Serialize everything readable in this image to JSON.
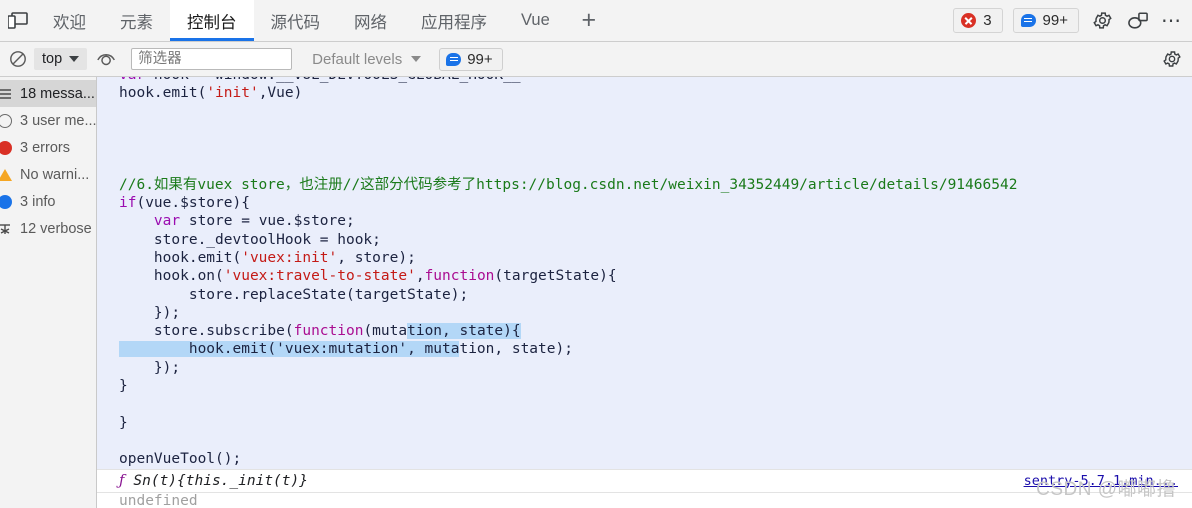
{
  "window": {
    "device_toolbar_icon": "device-toolbar-icon"
  },
  "tabbar": {
    "tabs": [
      {
        "label": "欢迎",
        "name": "tab-welcome",
        "active": false
      },
      {
        "label": "元素",
        "name": "tab-elements",
        "active": false
      },
      {
        "label": "控制台",
        "name": "tab-console",
        "active": true
      },
      {
        "label": "源代码",
        "name": "tab-sources",
        "active": false
      },
      {
        "label": "网络",
        "name": "tab-network",
        "active": false
      },
      {
        "label": "应用程序",
        "name": "tab-application",
        "active": false
      },
      {
        "label": "Vue",
        "name": "tab-vue",
        "active": false
      }
    ],
    "add_tab_label": "+",
    "error_count": "3",
    "message_count": "99+",
    "settings_icon": "gear-icon",
    "customize_icon": "devices-icon",
    "more_label": "⋯"
  },
  "console_toolbar": {
    "clear_icon": "clear-console-icon",
    "context_value": "top",
    "live_expression_icon": "eye-icon",
    "filter_placeholder": "筛选器",
    "filter_value": "",
    "levels_label": "Default levels",
    "badge_count": "99+",
    "settings_icon": "gear-icon"
  },
  "sidebar": {
    "items": [
      {
        "label": "18 messa...",
        "icon": "list-icon",
        "name": "sidebar-item-all-messages",
        "selected": true
      },
      {
        "label": "3 user me...",
        "icon": "circle-icon",
        "name": "sidebar-item-user-messages",
        "selected": false
      },
      {
        "label": "3 errors",
        "icon": "error-icon",
        "name": "sidebar-item-errors",
        "selected": false
      },
      {
        "label": "No warni...",
        "icon": "warning-icon",
        "name": "sidebar-item-warnings",
        "selected": false
      },
      {
        "label": "3 info",
        "icon": "info-icon",
        "name": "sidebar-item-info",
        "selected": false
      },
      {
        "label": "12 verbose",
        "icon": "verbose-icon",
        "name": "sidebar-item-verbose",
        "selected": false
      }
    ]
  },
  "console_output": {
    "code_lines": [
      {
        "segments": [
          {
            "t": "var",
            "c": "kw"
          },
          {
            "t": " hook = window.__VUE_DEVTOOLS_GLOBAL_HOOK__",
            "c": ""
          }
        ]
      },
      {
        "segments": [
          {
            "t": "hook.emit(",
            "c": ""
          },
          {
            "t": "'init'",
            "c": "str"
          },
          {
            "t": ",Vue)",
            "c": ""
          }
        ]
      },
      {
        "segments": []
      },
      {
        "segments": []
      },
      {
        "segments": []
      },
      {
        "segments": []
      },
      {
        "segments": [
          {
            "t": "//6.如果有vuex store，也注册//这部分代码参考了https://blog.csdn.net/weixin_34352449/article/details/91466542",
            "c": "cmt"
          }
        ]
      },
      {
        "segments": [
          {
            "t": "if",
            "c": "kw"
          },
          {
            "t": "(vue.$store){",
            "c": ""
          }
        ]
      },
      {
        "segments": [
          {
            "t": "    ",
            "c": ""
          },
          {
            "t": "var",
            "c": "kw"
          },
          {
            "t": " store = vue.$store;",
            "c": ""
          }
        ]
      },
      {
        "segments": [
          {
            "t": "    store._devtoolHook = hook;",
            "c": ""
          }
        ]
      },
      {
        "segments": [
          {
            "t": "    hook.emit(",
            "c": ""
          },
          {
            "t": "'vuex:init'",
            "c": "str"
          },
          {
            "t": ", store);",
            "c": ""
          }
        ]
      },
      {
        "segments": [
          {
            "t": "    hook.on(",
            "c": ""
          },
          {
            "t": "'vuex:travel-to-state'",
            "c": "str"
          },
          {
            "t": ",",
            "c": ""
          },
          {
            "t": "function",
            "c": "fn"
          },
          {
            "t": "(targetState){",
            "c": ""
          }
        ]
      },
      {
        "segments": [
          {
            "t": "        store.replaceState(targetState);",
            "c": ""
          }
        ]
      },
      {
        "segments": [
          {
            "t": "    });",
            "c": ""
          }
        ]
      },
      {
        "segments": [
          {
            "t": "    store.subscribe(",
            "c": ""
          },
          {
            "t": "function",
            "c": "fn"
          },
          {
            "t": "(muta",
            "c": ""
          },
          {
            "t": "tion, state){",
            "c": "sel"
          }
        ]
      },
      {
        "segments": [
          {
            "t": "        hook.emit('vuex:mutation', muta",
            "c": "sel"
          },
          {
            "t": "tion, state);",
            "c": ""
          }
        ]
      },
      {
        "segments": [
          {
            "t": "    });",
            "c": ""
          }
        ]
      },
      {
        "segments": [
          {
            "t": "}",
            "c": ""
          }
        ]
      },
      {
        "segments": []
      },
      {
        "segments": [
          {
            "t": "}",
            "c": ""
          }
        ]
      },
      {
        "segments": []
      },
      {
        "segments": [
          {
            "t": "openVueTool();",
            "c": ""
          }
        ]
      }
    ],
    "result_glyph": "ƒ",
    "result_value": "Sn(t){this._init(t)}",
    "source_link": "sentry-5.7.1.min...",
    "next_partial": "undefined"
  },
  "watermark": "CSDN @嘟嘟撸"
}
